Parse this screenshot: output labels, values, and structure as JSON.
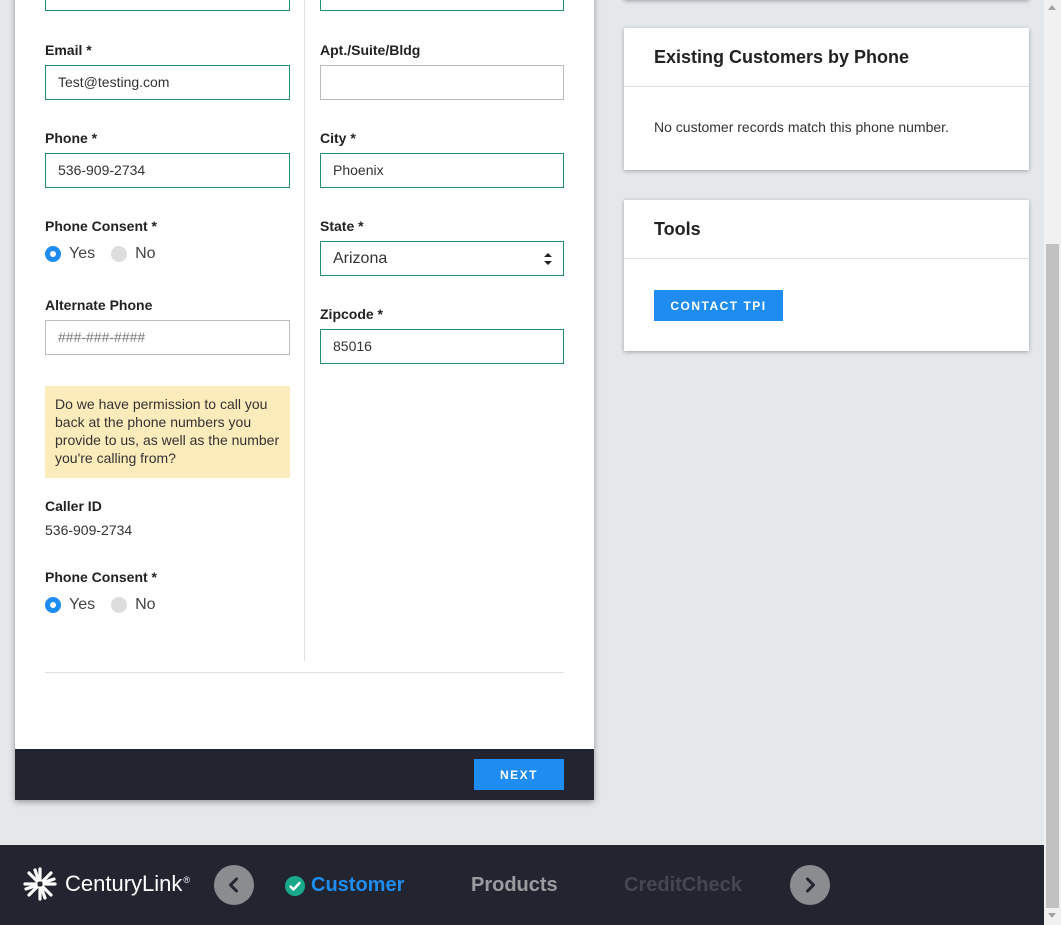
{
  "form": {
    "left": {
      "email_label": "Email *",
      "email_value": "Test@testing.com",
      "phone_label": "Phone *",
      "phone_value": "536-909-2734",
      "consent1_label": "Phone Consent *",
      "yes_label": "Yes",
      "no_label": "No",
      "alt_phone_label": "Alternate Phone",
      "alt_phone_placeholder": "###-###-####",
      "permission_note": "Do we have permission to call you back at the phone numbers you provide to us, as well as the number you're calling from?",
      "caller_id_label": "Caller ID",
      "caller_id_value": "536-909-2734",
      "consent2_label": "Phone Consent *"
    },
    "right": {
      "apt_label": "Apt./Suite/Bldg",
      "apt_value": "",
      "city_label": "City *",
      "city_value": "Phoenix",
      "state_label": "State *",
      "state_value": "Arizona",
      "zip_label": "Zipcode *",
      "zip_value": "85016"
    },
    "next_label": "NEXT"
  },
  "existing_customers": {
    "title": "Existing Customers by Phone",
    "message": "No customer records match this phone number."
  },
  "tools": {
    "title": "Tools",
    "contact_label": "CONTACT TPI"
  },
  "bottom_nav": {
    "brand": "CenturyLink",
    "steps": {
      "customer": "Customer",
      "products": "Products",
      "creditcheck": "CreditCheck"
    },
    "colors": {
      "active": "#1e8cf0",
      "inactive": "#9a9ca0",
      "disabled": "#4a4d55",
      "complete": "#1aa88a"
    }
  }
}
